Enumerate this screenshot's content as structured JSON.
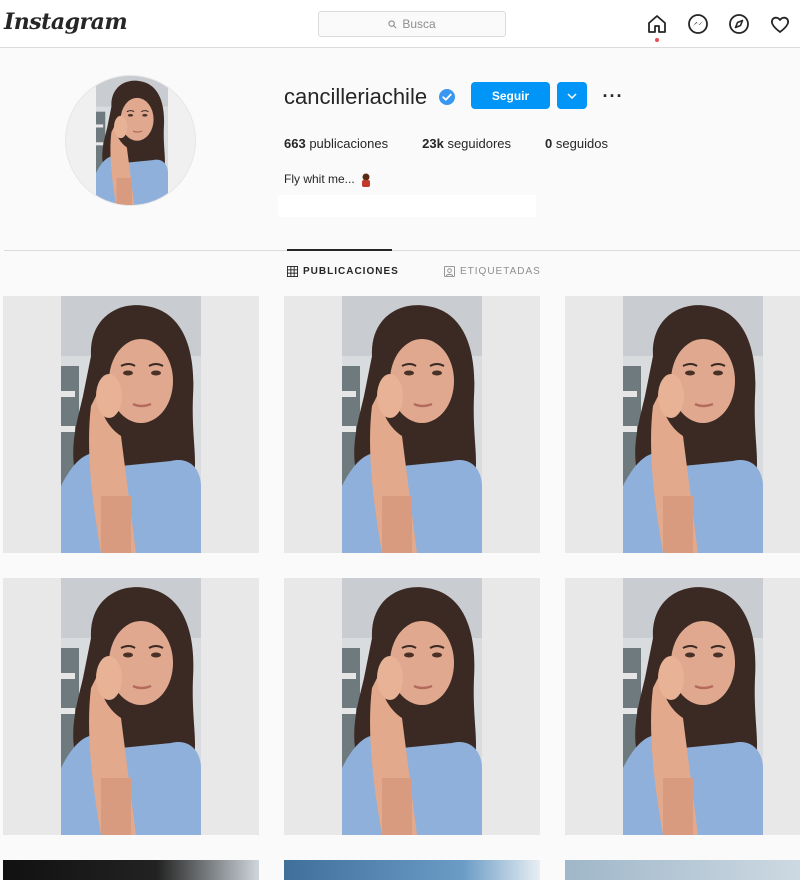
{
  "nav": {
    "logo": "Instagram",
    "search_placeholder": "Busca",
    "icons": [
      "home-icon",
      "messenger-icon",
      "explore-icon",
      "activity-heart-icon"
    ]
  },
  "profile": {
    "username": "cancilleriachile",
    "verified": true,
    "follow_label": "Seguir",
    "more_label": "···",
    "stats": {
      "posts_count": "663",
      "posts_label": "publicaciones",
      "followers_count": "23k",
      "followers_label": "seguidores",
      "following_count": "0",
      "following_label": "seguidos"
    },
    "bio": "Fly whit me..."
  },
  "tabs": {
    "posts": "PUBLICACIONES",
    "tagged": "ETIQUETADAS"
  },
  "colors": {
    "accent": "#0095f6",
    "border": "#dbdbdb",
    "bg": "#fafafa"
  }
}
